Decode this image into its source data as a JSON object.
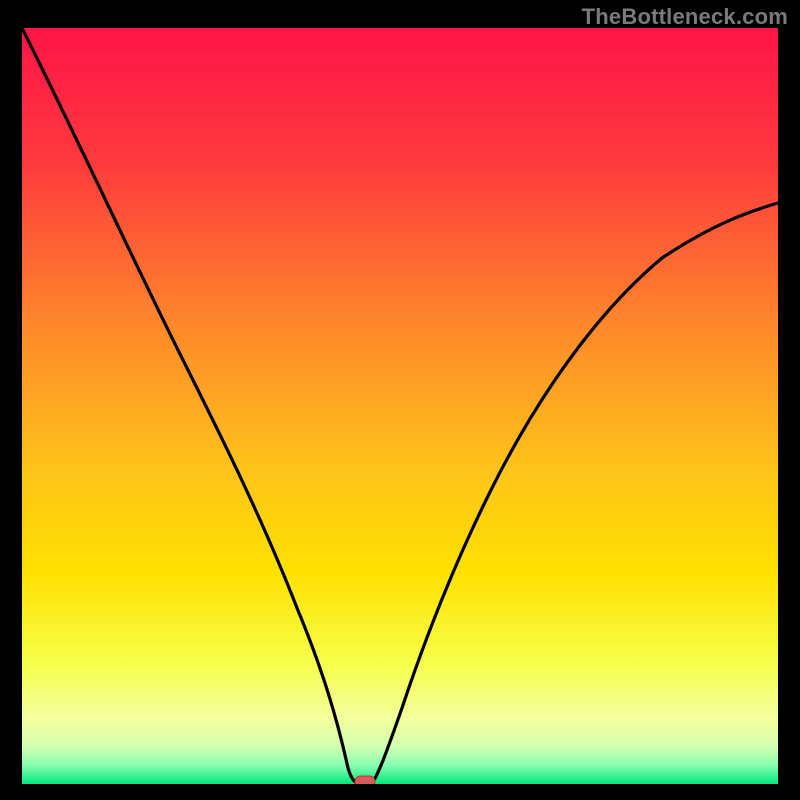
{
  "watermark": "TheBottleneck.com",
  "chart_data": {
    "type": "line",
    "title": "",
    "xlabel": "",
    "ylabel": "",
    "xlim": [
      0,
      100
    ],
    "ylim": [
      0,
      100
    ],
    "x": [
      0,
      5,
      10,
      15,
      20,
      25,
      30,
      35,
      38,
      40,
      42,
      43,
      44,
      46,
      50,
      55,
      60,
      65,
      70,
      75,
      80,
      85,
      90,
      95,
      100
    ],
    "values": [
      100,
      86,
      72,
      60,
      48,
      37,
      27,
      17,
      11,
      7,
      3,
      1,
      0,
      0,
      4,
      12,
      21,
      30,
      38,
      45,
      52,
      58,
      63,
      67,
      70
    ],
    "series": [
      {
        "name": "bottleneck-curve",
        "values": [
          100,
          86,
          72,
          60,
          48,
          37,
          27,
          17,
          11,
          7,
          3,
          1,
          0,
          0,
          4,
          12,
          21,
          30,
          38,
          45,
          52,
          58,
          63,
          67,
          70
        ]
      }
    ],
    "marker": {
      "x": 45,
      "y": 0,
      "color": "#d95a5a"
    },
    "background_gradient": {
      "top": "#ff1447",
      "mid_upper": "#ff7a2a",
      "mid": "#ffe100",
      "mid_lower": "#f4ff7a",
      "low": "#c8ff9a",
      "bottom": "#00e87a"
    }
  }
}
